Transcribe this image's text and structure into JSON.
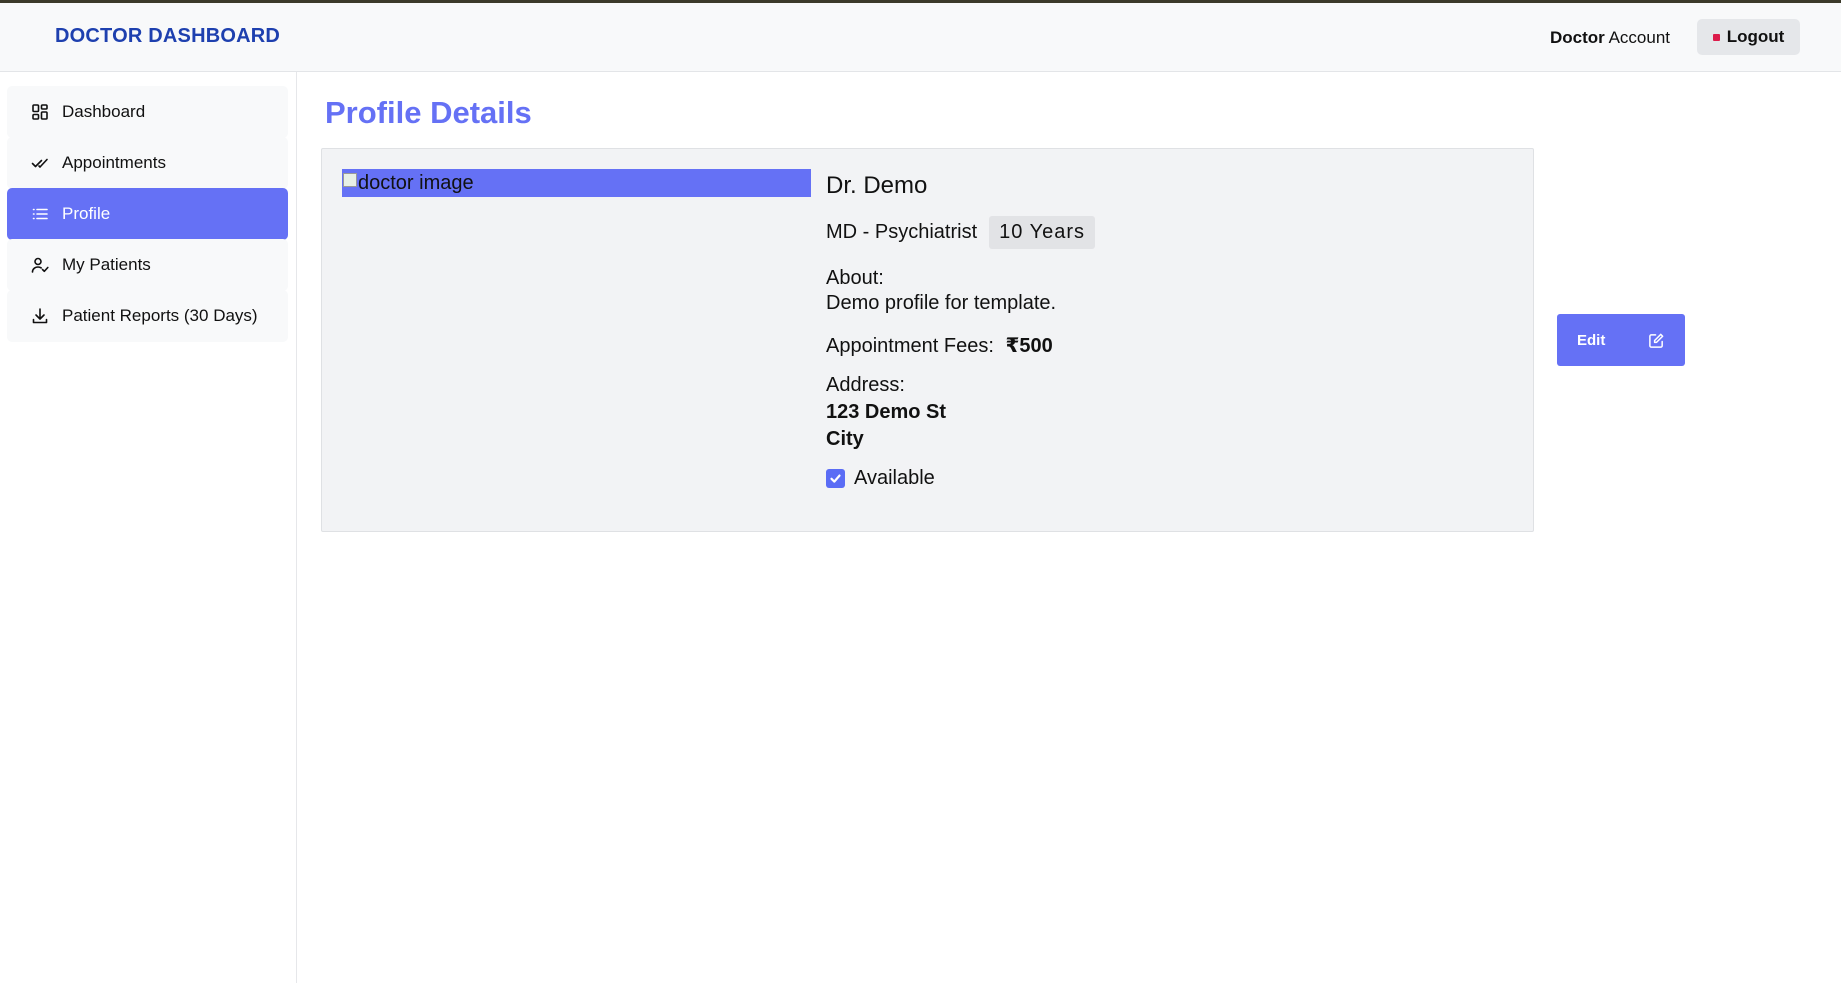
{
  "navbar": {
    "brand": "DOCTOR DASHBOARD",
    "account_bold": "Doctor",
    "account_rest": " Account",
    "logout_label": "Logout"
  },
  "sidebar": {
    "items": [
      {
        "label": "Dashboard",
        "icon": "grid-icon",
        "active": false
      },
      {
        "label": "Appointments",
        "icon": "double-check-icon",
        "active": false
      },
      {
        "label": "Profile",
        "icon": "list-icon",
        "active": true
      },
      {
        "label": "My Patients",
        "icon": "user-check-icon",
        "active": false
      },
      {
        "label": "Patient Reports (30 Days)",
        "icon": "download-icon",
        "active": false
      }
    ]
  },
  "main": {
    "title": "Profile Details",
    "profile": {
      "image_alt": "doctor image",
      "name": "Dr. Demo",
      "degree": "MD - Psychiatrist",
      "experience": "10 Years",
      "about_label": "About:",
      "about_text": "Demo profile for template.",
      "fees_label": "Appointment Fees:",
      "fees_value": "₹500",
      "address_label": "Address:",
      "address_line1": "123 Demo St",
      "address_line2": "City",
      "available_label": "Available",
      "available": true
    },
    "edit_label": "Edit"
  },
  "colors": {
    "accent": "#6571f5",
    "brand": "#1e40af",
    "logout_dot": "#dc1c4b"
  }
}
